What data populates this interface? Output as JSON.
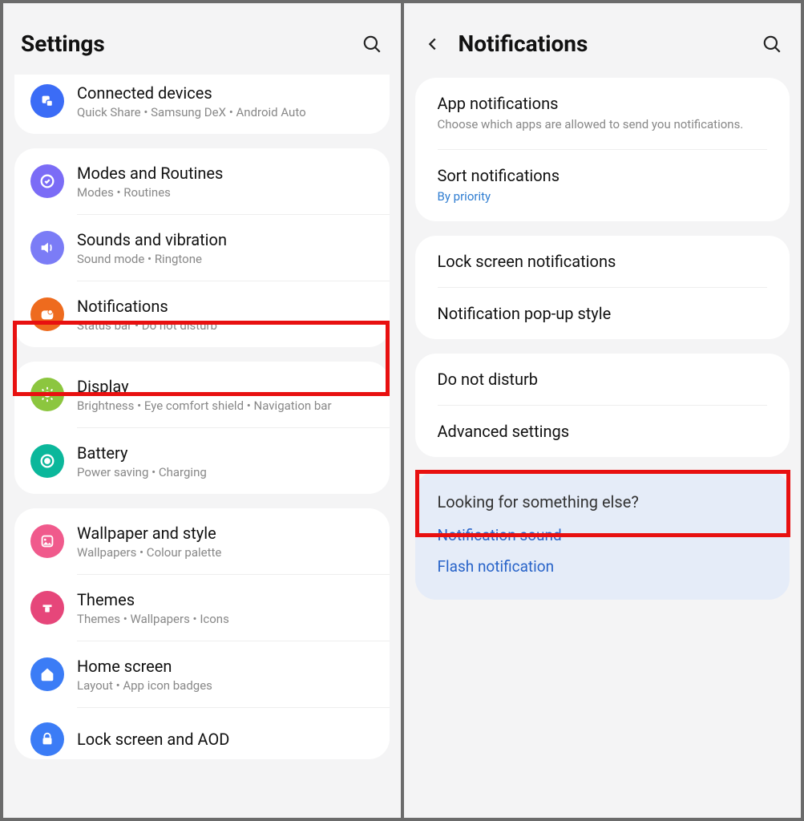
{
  "left": {
    "title": "Settings",
    "items": [
      {
        "title": "Connected devices",
        "sub": "Quick Share  •  Samsung DeX  •  Android Auto",
        "icon": "devices",
        "color": "#3b6cf6"
      },
      {
        "title": "Modes and Routines",
        "sub": "Modes  •  Routines",
        "icon": "routines",
        "color": "#7b6cf6"
      },
      {
        "title": "Sounds and vibration",
        "sub": "Sound mode  •  Ringtone",
        "icon": "sound",
        "color": "#7b7cf6"
      },
      {
        "title": "Notifications",
        "sub": "Status bar  •  Do not disturb",
        "icon": "notifications",
        "color": "#ee6b1e"
      },
      {
        "title": "Display",
        "sub": "Brightness  •  Eye comfort shield  •  Navigation bar",
        "icon": "display",
        "color": "#8cc63f"
      },
      {
        "title": "Battery",
        "sub": "Power saving  •  Charging",
        "icon": "battery",
        "color": "#0bb79b"
      },
      {
        "title": "Wallpaper and style",
        "sub": "Wallpapers  •  Colour palette",
        "icon": "wallpaper",
        "color": "#f05a8c"
      },
      {
        "title": "Themes",
        "sub": "Themes  •  Wallpapers  •  Icons",
        "icon": "themes",
        "color": "#e6467a"
      },
      {
        "title": "Home screen",
        "sub": "Layout  •  App icon badges",
        "icon": "home",
        "color": "#3b7cf6"
      },
      {
        "title": "Lock screen and AOD",
        "sub": "",
        "icon": "lock",
        "color": "#3b7cf6"
      }
    ]
  },
  "right": {
    "title": "Notifications",
    "group1": [
      {
        "title": "App notifications",
        "sub": "Choose which apps are allowed to send you notifications."
      },
      {
        "title": "Sort notifications",
        "sub": "By priority",
        "link": true
      }
    ],
    "group2": [
      {
        "title": "Lock screen notifications"
      },
      {
        "title": "Notification pop-up style"
      }
    ],
    "group3": [
      {
        "title": "Do not disturb"
      },
      {
        "title": "Advanced settings"
      }
    ],
    "help": {
      "title": "Looking for something else?",
      "links": [
        "Notification sound",
        "Flash notification"
      ]
    }
  }
}
